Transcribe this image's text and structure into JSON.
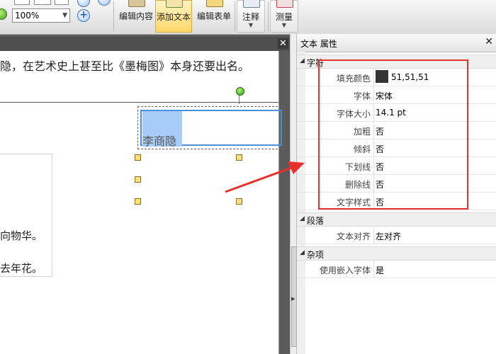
{
  "toolbar": {
    "zoom_value": "100%",
    "buttons": [
      {
        "label": "编辑内容"
      },
      {
        "label": "添加文本"
      },
      {
        "label": "编辑表单"
      },
      {
        "label": "注释"
      },
      {
        "label": "测量"
      }
    ],
    "zoom_in_symbol": "+"
  },
  "document": {
    "close_symbol": "✕",
    "line1": "隐，在艺术史上甚至比《墨梅图》本身还要出名。",
    "poem_line1": "向物华。",
    "poem_line2": "去年花。",
    "selected_text": "李商隐"
  },
  "panel": {
    "title": "文本 属性",
    "close_symbol": "✕",
    "categories": [
      {
        "name": "字符",
        "rows": [
          {
            "key": "填充颜色",
            "value": "51,51,51",
            "swatch": "#333333"
          },
          {
            "key": "字体",
            "value": "宋体"
          },
          {
            "key": "字体大小",
            "value": "14.1 pt"
          },
          {
            "key": "加粗",
            "value": "否"
          },
          {
            "key": "倾斜",
            "value": "否"
          },
          {
            "key": "下划线",
            "value": "否"
          },
          {
            "key": "删除线",
            "value": "否"
          },
          {
            "key": "文字样式",
            "value": "否"
          }
        ]
      },
      {
        "name": "段落",
        "rows": [
          {
            "key": "文本对齐",
            "value": "左对齐"
          }
        ]
      },
      {
        "name": "杂项",
        "rows": [
          {
            "key": "使用嵌入字体",
            "value": "是"
          }
        ]
      }
    ]
  },
  "colors": {
    "annotation_red": "#e8302c",
    "selection_blue": "#4a8fd9",
    "active_button": "#ffd76a"
  }
}
